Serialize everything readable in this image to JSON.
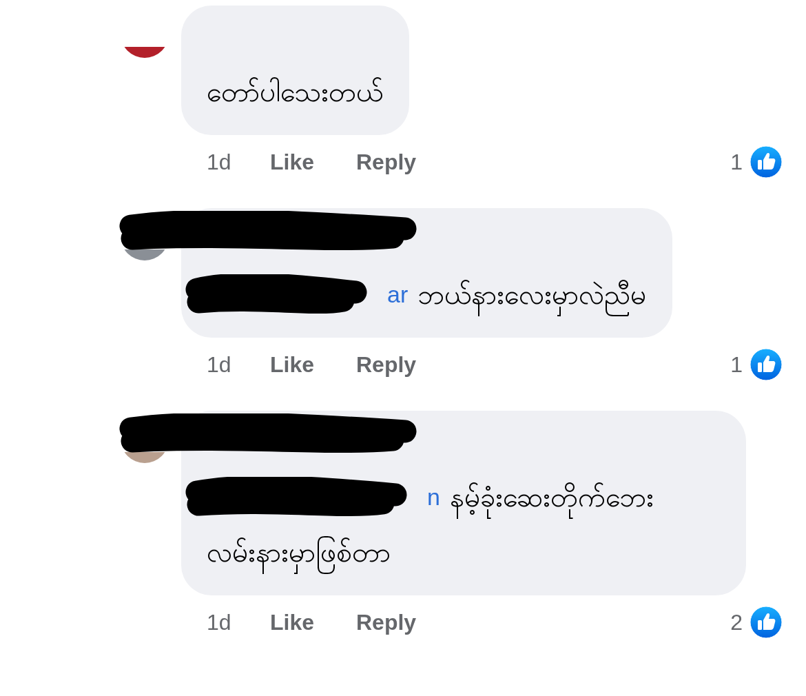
{
  "comments": [
    {
      "name_redacted": false,
      "lines": [
        "တော်ပါသေးတယ်"
      ],
      "time": "1d",
      "like": "Like",
      "reply": "Reply",
      "reaction_count": "1"
    },
    {
      "name_redacted": true,
      "mention": {
        "text": "ar"
      },
      "lines": [
        "ဘယ်နားလေးမှာလဲညီမ"
      ],
      "time": "1d",
      "like": "Like",
      "reply": "Reply",
      "reaction_count": "1"
    },
    {
      "name_redacted": true,
      "mention": {
        "text": "n"
      },
      "lines": [
        "နမ့်ခုံးဆေးတိုက်ဘေး",
        "လမ်းနားမှာဖြစ်တာ"
      ],
      "time": "1d",
      "like": "Like",
      "reply": "Reply",
      "reaction_count": "2"
    }
  ]
}
